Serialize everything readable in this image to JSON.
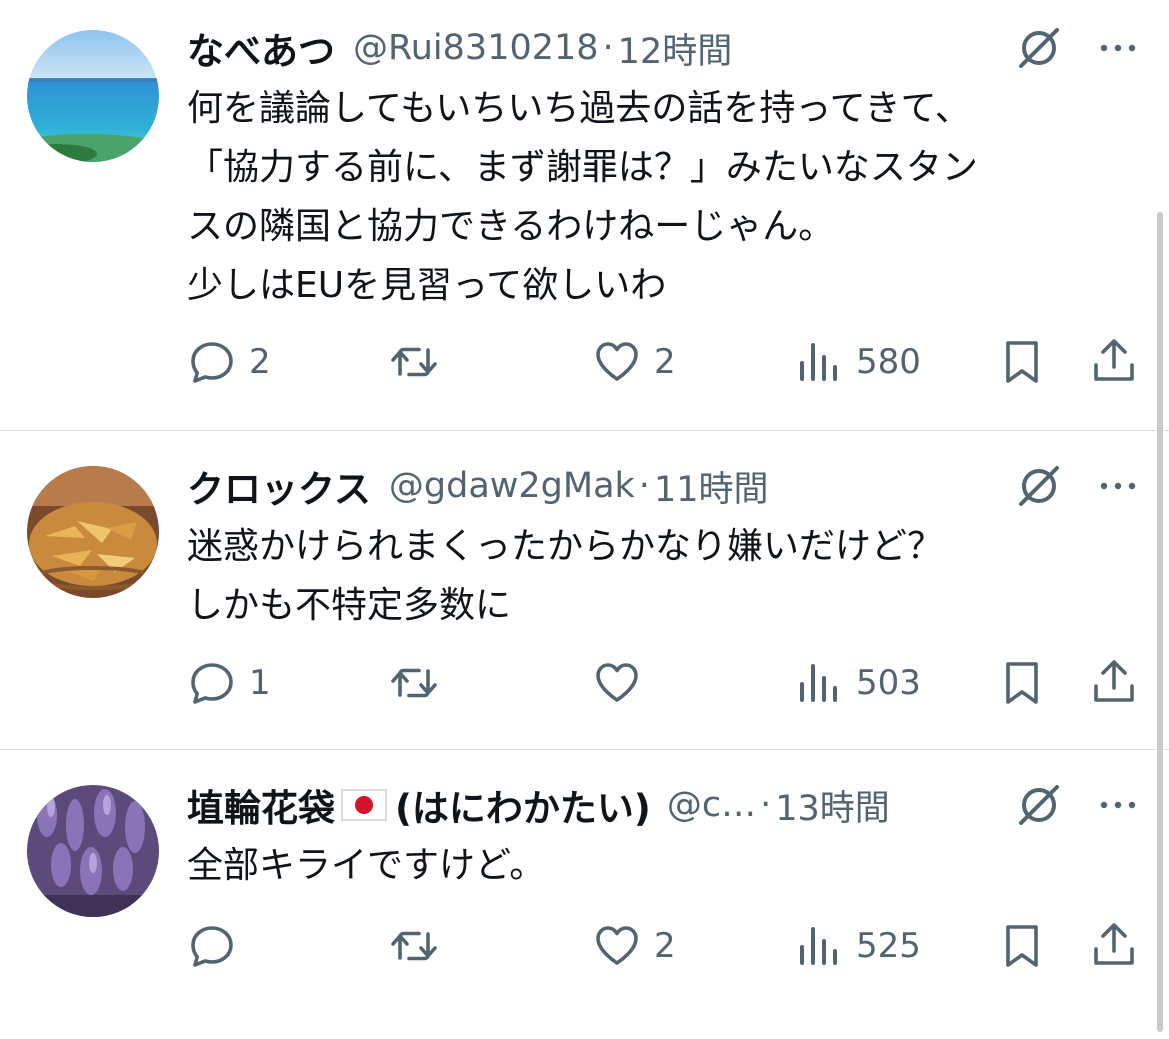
{
  "tweets": [
    {
      "name": "なべあつ",
      "handle": "@Rui8310218",
      "dot": "·",
      "time": "12時間",
      "text": "何を議論してもいちいち過去の話を持ってきて、\n「協力する前に、まず謝罪は？」みたいなスタン\nスの隣国と協力できるわけねーじゃん。\n少しはEUを見習って欲しいわ",
      "reply_count": "2",
      "retweet_count": "",
      "like_count": "2",
      "view_count": "580",
      "avatar_icon": "ocean-photo"
    },
    {
      "name": "クロックス",
      "handle": "@gdaw2gMak",
      "dot": "·",
      "time": "11時間",
      "text": "迷惑かけられまくったからかなり嫌いだけど？\nしかも不特定多数に",
      "reply_count": "1",
      "retweet_count": "",
      "like_count": "",
      "view_count": "503",
      "avatar_icon": "chips-photo"
    },
    {
      "name": "埴輪花袋",
      "name_suffix": "(はにわかたい)",
      "handle": "@c…",
      "dot": "·",
      "time": "13時間",
      "text": "全部キライですけど。",
      "reply_count": "",
      "retweet_count": "",
      "like_count": "2",
      "view_count": "525",
      "avatar_icon": "wisteria-photo"
    }
  ],
  "icons": {
    "reply": "reply-icon",
    "retweet": "retweet-icon",
    "like": "heart-icon",
    "views": "views-icon",
    "bookmark": "bookmark-icon",
    "share": "share-icon",
    "grok": "grok-icon",
    "more": "more-icon",
    "flag": "japan-flag-icon"
  },
  "colors": {
    "text": "#0f1419",
    "secondary": "#536471",
    "divider": "#dcdfe2"
  }
}
